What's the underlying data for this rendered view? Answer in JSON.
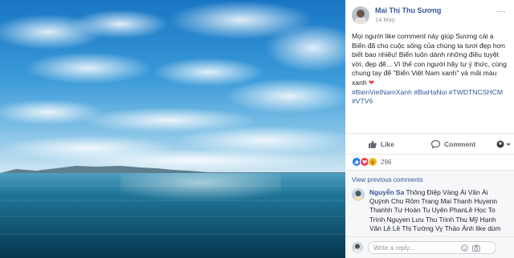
{
  "post": {
    "author": "Mai Thị Thu Sương",
    "date": "14 May",
    "more_icon": "···",
    "text": "Mọi người like comment này giúp Sương cái ạ Biển đã cho cuộc sống của chúng ta tươi đẹp hơn biết bao nhiêu! Biển luôn dành những điều tuyệt vời, đẹp đẽ... Vì thế con người hãy tự ý thức, cùng chung tay để \"Biển Việt Nam xanh\" và mãi màu xanh",
    "heart": "❤",
    "hashtags": "#BienVietNamXanh #BiaHaNoi #TWDTNCSHCM #VTV6"
  },
  "actions": {
    "like_label": "Like",
    "comment_label": "Comment"
  },
  "reactions": {
    "count": "296"
  },
  "comments": {
    "view_previous": "View previous comments",
    "items": [
      {
        "name": "Nguyễn Sa",
        "text": "Thông Điệp Vàng Ái Vân Ái Quỳnh Chu Rôm Trang Mai Thanh Huyenn Thanhh Tư Hoàn Tu Uyên PhanLê Học To Trình Nguyen Lưu Thu Trinh Thu Mỹ Hạnh Vân Lê Lê Thị Tường Vy Thảo Ánh like dùm bài bạn mình với"
      }
    ],
    "write_placeholder": "Write a reply..."
  },
  "colors": {
    "link": "#385898",
    "sky_top": "#1f7ec9",
    "sea": "#0e5a7a"
  }
}
